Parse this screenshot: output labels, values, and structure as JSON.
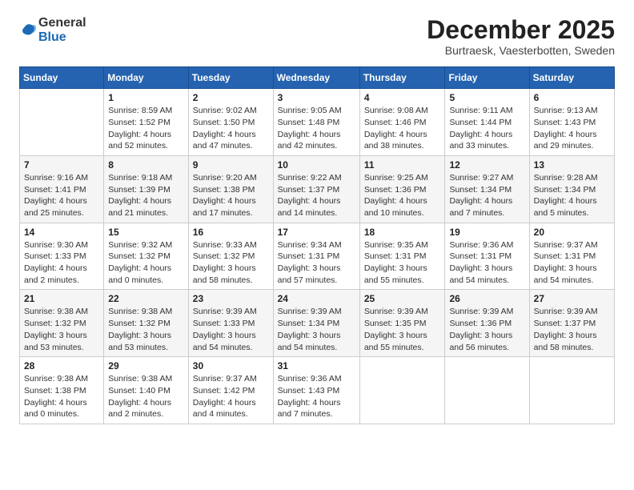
{
  "logo": {
    "general": "General",
    "blue": "Blue"
  },
  "title": "December 2025",
  "subtitle": "Burtraesk, Vaesterbotten, Sweden",
  "weekdays": [
    "Sunday",
    "Monday",
    "Tuesday",
    "Wednesday",
    "Thursday",
    "Friday",
    "Saturday"
  ],
  "weeks": [
    [
      {
        "day": "",
        "info": ""
      },
      {
        "day": "1",
        "info": "Sunrise: 8:59 AM\nSunset: 1:52 PM\nDaylight: 4 hours\nand 52 minutes."
      },
      {
        "day": "2",
        "info": "Sunrise: 9:02 AM\nSunset: 1:50 PM\nDaylight: 4 hours\nand 47 minutes."
      },
      {
        "day": "3",
        "info": "Sunrise: 9:05 AM\nSunset: 1:48 PM\nDaylight: 4 hours\nand 42 minutes."
      },
      {
        "day": "4",
        "info": "Sunrise: 9:08 AM\nSunset: 1:46 PM\nDaylight: 4 hours\nand 38 minutes."
      },
      {
        "day": "5",
        "info": "Sunrise: 9:11 AM\nSunset: 1:44 PM\nDaylight: 4 hours\nand 33 minutes."
      },
      {
        "day": "6",
        "info": "Sunrise: 9:13 AM\nSunset: 1:43 PM\nDaylight: 4 hours\nand 29 minutes."
      }
    ],
    [
      {
        "day": "7",
        "info": "Sunrise: 9:16 AM\nSunset: 1:41 PM\nDaylight: 4 hours\nand 25 minutes."
      },
      {
        "day": "8",
        "info": "Sunrise: 9:18 AM\nSunset: 1:39 PM\nDaylight: 4 hours\nand 21 minutes."
      },
      {
        "day": "9",
        "info": "Sunrise: 9:20 AM\nSunset: 1:38 PM\nDaylight: 4 hours\nand 17 minutes."
      },
      {
        "day": "10",
        "info": "Sunrise: 9:22 AM\nSunset: 1:37 PM\nDaylight: 4 hours\nand 14 minutes."
      },
      {
        "day": "11",
        "info": "Sunrise: 9:25 AM\nSunset: 1:36 PM\nDaylight: 4 hours\nand 10 minutes."
      },
      {
        "day": "12",
        "info": "Sunrise: 9:27 AM\nSunset: 1:34 PM\nDaylight: 4 hours\nand 7 minutes."
      },
      {
        "day": "13",
        "info": "Sunrise: 9:28 AM\nSunset: 1:34 PM\nDaylight: 4 hours\nand 5 minutes."
      }
    ],
    [
      {
        "day": "14",
        "info": "Sunrise: 9:30 AM\nSunset: 1:33 PM\nDaylight: 4 hours\nand 2 minutes."
      },
      {
        "day": "15",
        "info": "Sunrise: 9:32 AM\nSunset: 1:32 PM\nDaylight: 4 hours\nand 0 minutes."
      },
      {
        "day": "16",
        "info": "Sunrise: 9:33 AM\nSunset: 1:32 PM\nDaylight: 3 hours\nand 58 minutes."
      },
      {
        "day": "17",
        "info": "Sunrise: 9:34 AM\nSunset: 1:31 PM\nDaylight: 3 hours\nand 57 minutes."
      },
      {
        "day": "18",
        "info": "Sunrise: 9:35 AM\nSunset: 1:31 PM\nDaylight: 3 hours\nand 55 minutes."
      },
      {
        "day": "19",
        "info": "Sunrise: 9:36 AM\nSunset: 1:31 PM\nDaylight: 3 hours\nand 54 minutes."
      },
      {
        "day": "20",
        "info": "Sunrise: 9:37 AM\nSunset: 1:31 PM\nDaylight: 3 hours\nand 54 minutes."
      }
    ],
    [
      {
        "day": "21",
        "info": "Sunrise: 9:38 AM\nSunset: 1:32 PM\nDaylight: 3 hours\nand 53 minutes."
      },
      {
        "day": "22",
        "info": "Sunrise: 9:38 AM\nSunset: 1:32 PM\nDaylight: 3 hours\nand 53 minutes."
      },
      {
        "day": "23",
        "info": "Sunrise: 9:39 AM\nSunset: 1:33 PM\nDaylight: 3 hours\nand 54 minutes."
      },
      {
        "day": "24",
        "info": "Sunrise: 9:39 AM\nSunset: 1:34 PM\nDaylight: 3 hours\nand 54 minutes."
      },
      {
        "day": "25",
        "info": "Sunrise: 9:39 AM\nSunset: 1:35 PM\nDaylight: 3 hours\nand 55 minutes."
      },
      {
        "day": "26",
        "info": "Sunrise: 9:39 AM\nSunset: 1:36 PM\nDaylight: 3 hours\nand 56 minutes."
      },
      {
        "day": "27",
        "info": "Sunrise: 9:39 AM\nSunset: 1:37 PM\nDaylight: 3 hours\nand 58 minutes."
      }
    ],
    [
      {
        "day": "28",
        "info": "Sunrise: 9:38 AM\nSunset: 1:38 PM\nDaylight: 4 hours\nand 0 minutes."
      },
      {
        "day": "29",
        "info": "Sunrise: 9:38 AM\nSunset: 1:40 PM\nDaylight: 4 hours\nand 2 minutes."
      },
      {
        "day": "30",
        "info": "Sunrise: 9:37 AM\nSunset: 1:42 PM\nDaylight: 4 hours\nand 4 minutes."
      },
      {
        "day": "31",
        "info": "Sunrise: 9:36 AM\nSunset: 1:43 PM\nDaylight: 4 hours\nand 7 minutes."
      },
      {
        "day": "",
        "info": ""
      },
      {
        "day": "",
        "info": ""
      },
      {
        "day": "",
        "info": ""
      }
    ]
  ]
}
